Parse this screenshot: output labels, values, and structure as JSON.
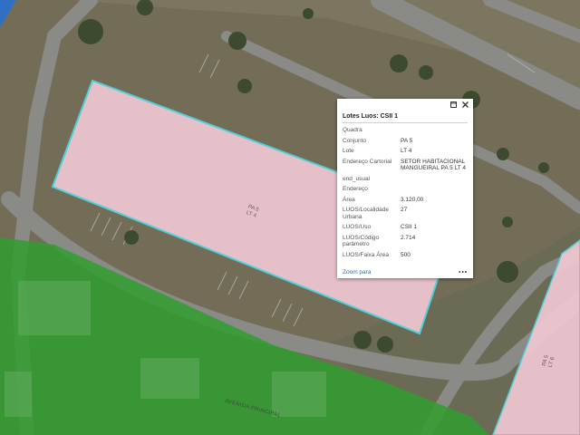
{
  "parcels": [
    {
      "line1": "PA 5",
      "line2": "LT 4"
    },
    {
      "line1": "PA 5",
      "line2": "LT 6"
    }
  ],
  "road_label": "AVENIDA PRINCIPAL",
  "colors": {
    "parcel_fill": "#f0c8d2",
    "parcel_outline": "#4fd0d8",
    "zone_green": "#2f9e2f"
  },
  "popup": {
    "icons": {
      "maximize": "maximize-icon",
      "close": "close-icon"
    },
    "title": "Lotes Luos: CSII 1",
    "rows": [
      {
        "k": "Quadra",
        "v": ""
      },
      {
        "k": "Conjunto",
        "v": "PA 5"
      },
      {
        "k": "Lote",
        "v": "LT 4"
      },
      {
        "k": "Endereço Cartorial",
        "v": "SETOR HABITACIONAL MANGUEIRAL PA 5 LT 4"
      },
      {
        "k": "end_usual",
        "v": ""
      },
      {
        "k": "Endereço",
        "v": ""
      },
      {
        "k": "Área",
        "v": "3.120,00"
      },
      {
        "k": "LUOS/Localidade Urbana",
        "v": "27"
      },
      {
        "k": "LUOS/Uso",
        "v": "CSII 1"
      },
      {
        "k": "LUOS/Código parâmetro",
        "v": "2.714"
      },
      {
        "k": "LUOS/Faixa Área",
        "v": "500"
      }
    ],
    "zoom_label": "Zoom para",
    "more_label": "•••"
  }
}
